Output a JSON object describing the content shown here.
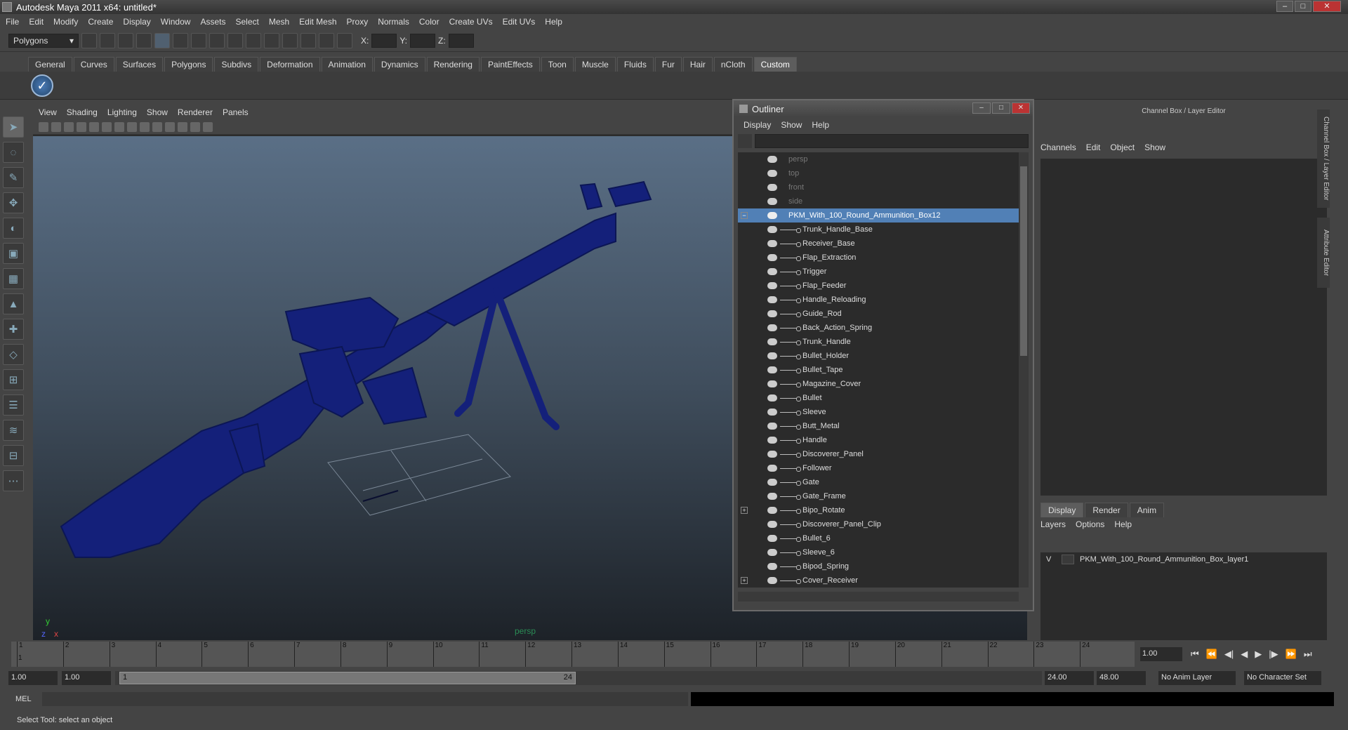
{
  "window": {
    "title": "Autodesk Maya 2011 x64: untitled*"
  },
  "menu": [
    "File",
    "Edit",
    "Modify",
    "Create",
    "Display",
    "Window",
    "Assets",
    "Select",
    "Mesh",
    "Edit Mesh",
    "Proxy",
    "Normals",
    "Color",
    "Create UVs",
    "Edit UVs",
    "Help"
  ],
  "statusline": {
    "mode": "Polygons",
    "x_label": "X:",
    "y_label": "Y:",
    "z_label": "Z:"
  },
  "shelf": {
    "tabs": [
      "General",
      "Curves",
      "Surfaces",
      "Polygons",
      "Subdivs",
      "Deformation",
      "Animation",
      "Dynamics",
      "Rendering",
      "PaintEffects",
      "Toon",
      "Muscle",
      "Fluids",
      "Fur",
      "Hair",
      "nCloth",
      "Custom"
    ],
    "active": "Custom"
  },
  "viewport": {
    "menu": [
      "View",
      "Shading",
      "Lighting",
      "Show",
      "Renderer",
      "Panels"
    ],
    "camera": "persp",
    "axis_y": "y",
    "axis_x": "x",
    "axis_z": "z"
  },
  "outliner": {
    "title": "Outliner",
    "menu": [
      "Display",
      "Show",
      "Help"
    ],
    "cameras": [
      "persp",
      "top",
      "front",
      "side"
    ],
    "root": "PKM_With_100_Round_Ammunition_Box12",
    "children": [
      "Trunk_Handle_Base",
      "Receiver_Base",
      "Flap_Extraction",
      "Trigger",
      "Flap_Feeder",
      "Handle_Reloading",
      "Guide_Rod",
      "Back_Action_Spring",
      "Trunk_Handle",
      "Bullet_Holder",
      "Bullet_Tape",
      "Magazine_Cover",
      "Bullet",
      "Sleeve",
      "Butt_Metal",
      "Handle",
      "Discoverer_Panel",
      "Follower",
      "Gate",
      "Gate_Frame",
      "Bipo_Rotate",
      "Discoverer_Panel_Clip",
      "Bullet_6",
      "Sleeve_6",
      "Bipod_Spring",
      "Cover_Receiver"
    ],
    "expandable": [
      "Bipo_Rotate",
      "Cover_Receiver"
    ]
  },
  "channelbox": {
    "title": "Channel Box / Layer Editor",
    "menu": [
      "Channels",
      "Edit",
      "Object",
      "Show"
    ],
    "layer_tabs": [
      "Display",
      "Render",
      "Anim"
    ],
    "layer_menu": [
      "Layers",
      "Options",
      "Help"
    ],
    "layer": {
      "vis": "V",
      "name": "PKM_With_100_Round_Ammunition_Box_layer1"
    },
    "side_tab_1": "Channel Box / Layer Editor",
    "side_tab_2": "Attribute Editor"
  },
  "timeline": {
    "ticks": [
      "1",
      "2",
      "3",
      "4",
      "5",
      "6",
      "7",
      "8",
      "9",
      "10",
      "11",
      "12",
      "13",
      "14",
      "15",
      "16",
      "17",
      "18",
      "19",
      "20",
      "21",
      "22",
      "23",
      "24"
    ],
    "current": "1.00",
    "marker": "1"
  },
  "range": {
    "start": "1.00",
    "start2": "1.00",
    "handle_start": "1",
    "handle_end": "24",
    "end": "24.00",
    "end2": "48.00",
    "anim_layer": "No Anim Layer",
    "char_set": "No Character Set"
  },
  "cmd": {
    "label": "MEL"
  },
  "help": {
    "text": "Select Tool: select an object"
  }
}
